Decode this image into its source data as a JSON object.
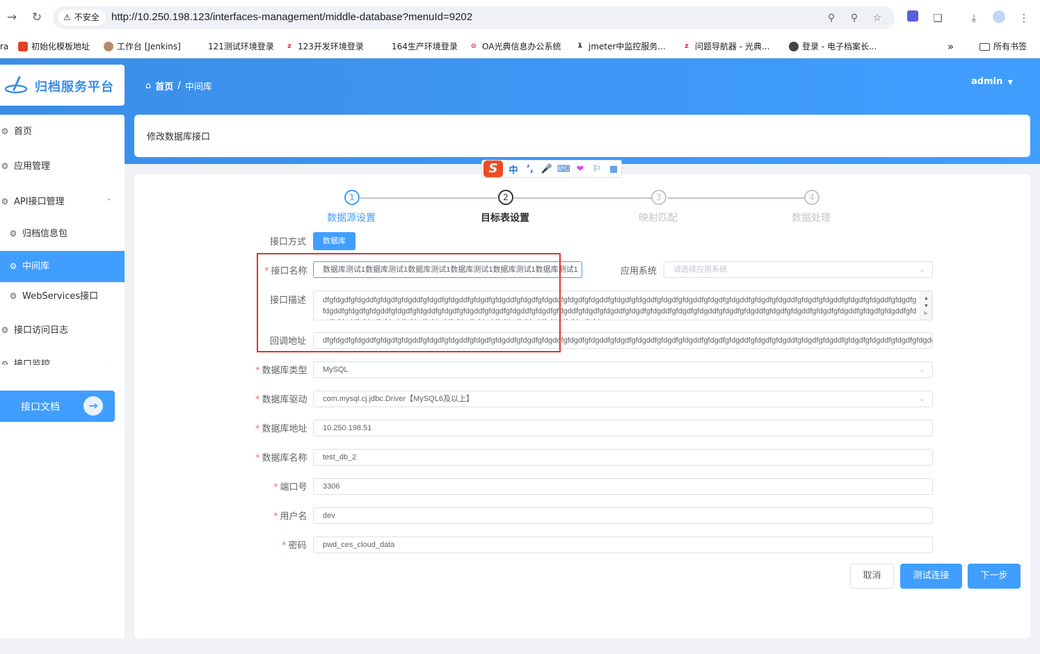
{
  "browser": {
    "security_label": "不安全",
    "url": "http://10.250.198.123/interfaces-management/middle-database?menuId=9202",
    "bookmarks": [
      {
        "label": "ra"
      },
      {
        "label": "初始化模板地址"
      },
      {
        "label": "工作台 [Jenkins]"
      },
      {
        "label": "121测试环境登录"
      },
      {
        "label": "123开发环境登录"
      },
      {
        "label": "164生产环境登录"
      },
      {
        "label": "OA光典信息办公系统"
      },
      {
        "label": "jmeter中监控服务..."
      },
      {
        "label": "问题导航器 - 光典..."
      },
      {
        "label": "登录 - 电子档案长..."
      }
    ],
    "more_label": "»",
    "all_bookmarks": "所有书签"
  },
  "app": {
    "logo_text": "归档服务平台",
    "breadcrumb": [
      "首页",
      "中间库"
    ],
    "breadcrumb_sep": "/",
    "user": "admin",
    "colors": {
      "primary": "#409eff",
      "danger": "#f56c6c",
      "highlight": "#e03131"
    }
  },
  "sidebar": {
    "items": [
      {
        "label": "首页",
        "icon": "gear-icon"
      },
      {
        "label": "应用管理",
        "icon": "gear-icon"
      },
      {
        "label": "API接口管理",
        "icon": "gear-icon"
      },
      {
        "label": "归档信息包",
        "icon": "gear-icon"
      },
      {
        "label": "中间库",
        "icon": "gear-icon"
      },
      {
        "label": "WebServices接口",
        "icon": "gear-icon"
      },
      {
        "label": "接口访问日志",
        "icon": "gear-icon"
      },
      {
        "label": "接口监控",
        "icon": "gear-icon"
      }
    ],
    "doc_button": "接口文档"
  },
  "page": {
    "title": "修改数据库接口"
  },
  "steps": [
    {
      "num": "1",
      "label": "数据源设置",
      "state": "done"
    },
    {
      "num": "2",
      "label": "目标表设置",
      "state": "current"
    },
    {
      "num": "3",
      "label": "映射匹配",
      "state": "pending"
    },
    {
      "num": "4",
      "label": "数据处理",
      "state": "pending"
    }
  ],
  "form": {
    "method_label": "接口方式",
    "method_value": "数据库",
    "name_label": "接口名称",
    "name_value": "数据库测试1数据库测试1数据库测试1数据库测试1数据库测试1数据库测试1",
    "app_label": "应用系统",
    "app_placeholder": "请选择应用系统",
    "desc_label": "接口描述",
    "desc_value": "dfgfdgdfgfdgddfgfdgdfgfdgddfgfdgdfgfdgddfgfdgdfgfdgddfgfdgdfgfdgddfgfdgdfgfdgddfgfdgdfgfdgddfgfdgdfgfdgddfgfdgdfgfdgddfgfdgdfgfdgddfgfdgdfgfdgddfgfdgdfgfdgddfgfdgdfgfdgddfgfdgdfgfdgddfgfdgdfgfdgddfgfdgdfgfdgddfgfdgdfgfdgddfgfdgdfgfdgddfgfdgdfgfdgddfgfdgdfgfdgddfgfdgdfgfdgddfgfdgdfgfdgddfgfdgdfgfdgddfgfdgdfgfdgddfgfdgdfgfdgddfgfdgdfgfdgddfgfdgdfgfdgddfgfdgdfgfdgddfgfdgdfgfdgddfgfdgdfgfdgddfgfdgdfgfdgdfgfdg",
    "callback_label": "回调地址",
    "callback_value": "dfgfdgdfgfdgddfgfdgdfgfdgddfgfdgdfgfdgddfgfdgdfgfdgddfgfdgdfgfdgddfgfdgdfgfdgddfgfdgdfgfdgddfgfdgdfgfdgddfgfdgdfgfdgddfgfdgdfgfdgddfgfdgdfgfdgddfgfdgdfgfdgddfgfdgdfgfdgdd",
    "dbtype_label": "数据库类型",
    "dbtype_value": "MySQL",
    "driver_label": "数据库驱动",
    "driver_value": "com.mysql.cj.jdbc.Driver【MySQL6及以上】",
    "dbaddr_label": "数据库地址",
    "dbaddr_value": "10.250.198.51",
    "dbname_label": "数据库名称",
    "dbname_value": "test_db_2",
    "port_label": "端口号",
    "port_value": "3306",
    "user_label": "用户名",
    "user_value": "dev",
    "pwd_label": "密码",
    "pwd_value": "pwd_ces_cloud_data"
  },
  "actions": {
    "cancel": "取消",
    "test": "测试连接",
    "next": "下一步"
  },
  "ime": {
    "logo": "S",
    "mode": "中"
  }
}
